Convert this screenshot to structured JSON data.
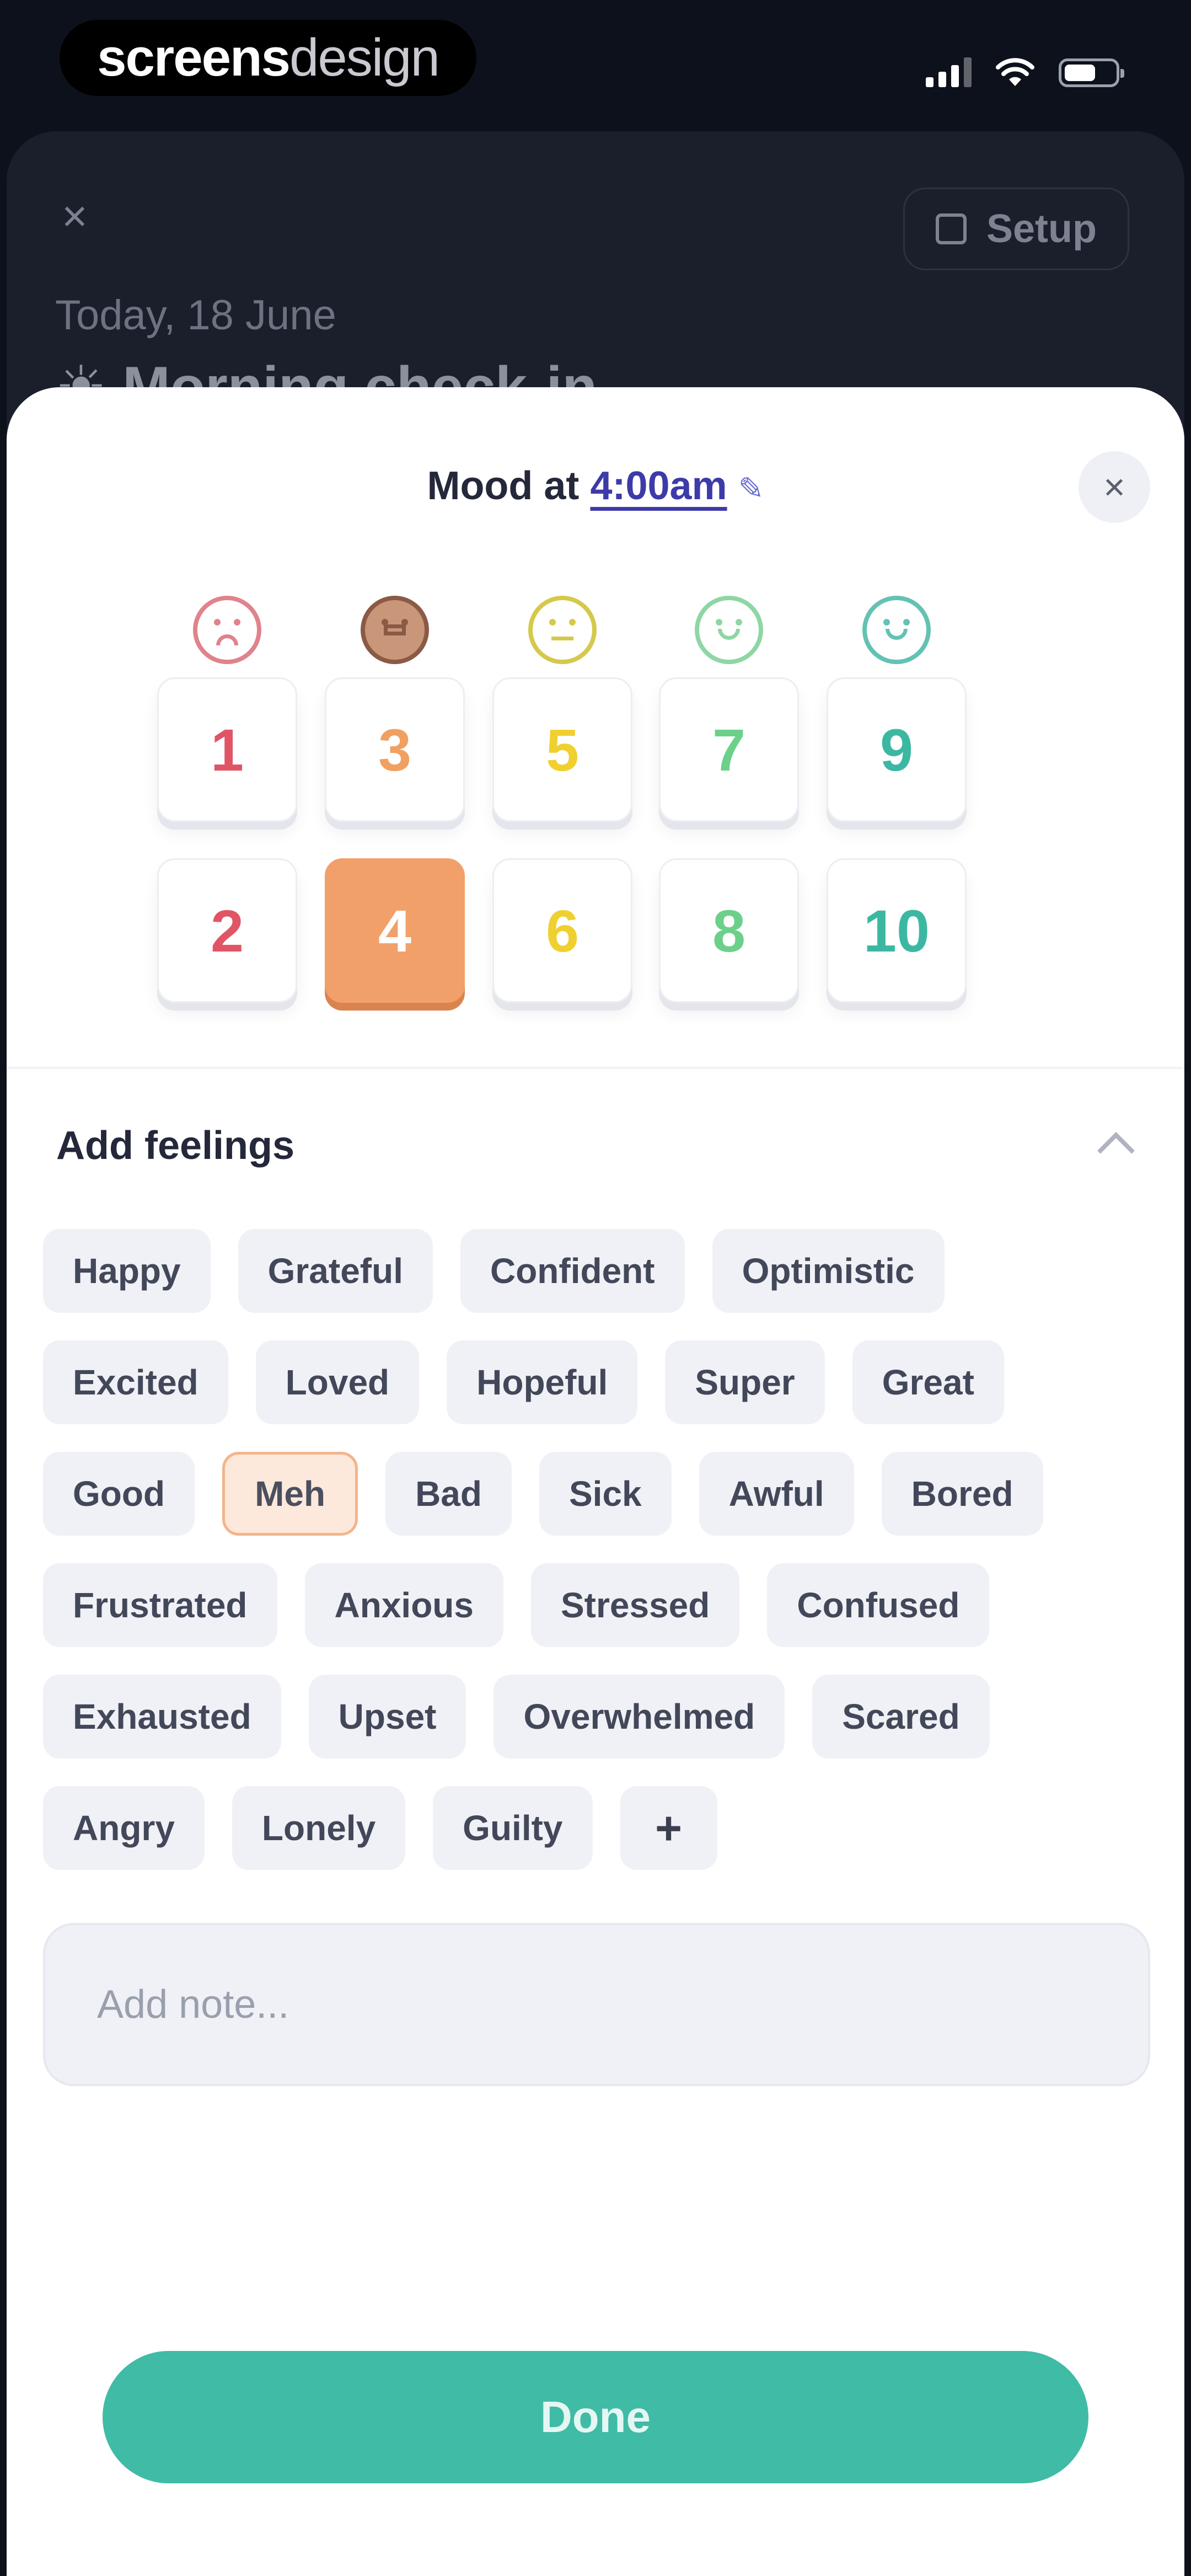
{
  "status_bar": {
    "brand_bold": "screens",
    "brand_light": "design"
  },
  "background": {
    "close_icon": "×",
    "setup_label": "Setup",
    "date": "Today, 18 June",
    "title": "☀ Morning check-in"
  },
  "sheet": {
    "title_prefix": "Mood at",
    "time": "4:00am",
    "pencil_icon": "✎",
    "close_icon": "×"
  },
  "mood": {
    "faces": [
      {
        "name": "very-sad-face-icon",
        "color": "#e0838c",
        "type": "sad"
      },
      {
        "name": "sad-face-icon",
        "color": "#8a5a45",
        "type": "filled"
      },
      {
        "name": "neutral-face-icon",
        "color": "#d4c94a",
        "type": "flat"
      },
      {
        "name": "content-face-icon",
        "color": "#8ed6a4",
        "type": "happy"
      },
      {
        "name": "happy-face-icon",
        "color": "#63c2b3",
        "type": "happy"
      }
    ],
    "values": [
      {
        "n": "1",
        "color": "#e05565"
      },
      {
        "n": "2",
        "color": "#e05565"
      },
      {
        "n": "3",
        "color": "#f0a060"
      },
      {
        "n": "4",
        "color": "#f0a060"
      },
      {
        "n": "5",
        "color": "#f0d030"
      },
      {
        "n": "6",
        "color": "#f0d030"
      },
      {
        "n": "7",
        "color": "#6cd08a"
      },
      {
        "n": "8",
        "color": "#6cd08a"
      },
      {
        "n": "9",
        "color": "#3cb8a2"
      },
      {
        "n": "10",
        "color": "#3cb8a2"
      }
    ],
    "selected": "4"
  },
  "feelings": {
    "title": "Add feelings",
    "rows": [
      [
        "Happy",
        "Grateful",
        "Confident",
        "Optimistic"
      ],
      [
        "Excited",
        "Loved",
        "Hopeful",
        "Super",
        "Great"
      ],
      [
        "Good",
        "Meh",
        "Bad",
        "Sick",
        "Awful",
        "Bored"
      ],
      [
        "Frustrated",
        "Anxious",
        "Stressed",
        "Confused"
      ],
      [
        "Exhausted",
        "Upset",
        "Overwhelmed",
        "Scared"
      ],
      [
        "Angry",
        "Lonely",
        "Guilty"
      ]
    ],
    "selected": "Meh",
    "add_label": "+"
  },
  "note": {
    "placeholder": "Add note..."
  },
  "done_label": "Done"
}
